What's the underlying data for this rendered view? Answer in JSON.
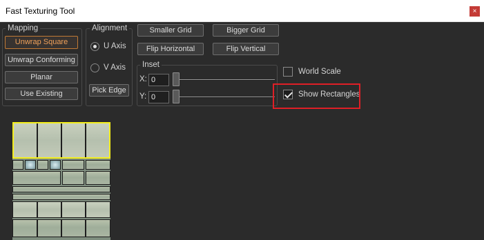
{
  "window": {
    "title": "Fast Texturing Tool",
    "close_glyph": "×"
  },
  "mapping": {
    "legend": "Mapping",
    "buttons": [
      "Unwrap Square",
      "Unwrap Conforming",
      "Planar",
      "Use Existing"
    ],
    "active_index": 0
  },
  "alignment": {
    "legend": "Alignment",
    "u_axis": "U Axis",
    "v_axis": "V Axis",
    "selected": "U Axis",
    "pick_edge": "Pick Edge"
  },
  "grid_buttons": {
    "smaller_grid": "Smaller Grid",
    "bigger_grid": "Bigger Grid",
    "flip_horizontal": "Flip Horizontal",
    "flip_vertical": "Flip Vertical"
  },
  "inset": {
    "legend": "Inset",
    "x_label": "X:",
    "x_value": "0",
    "y_label": "Y:",
    "y_value": "0"
  },
  "options": {
    "world_scale": {
      "label": "World Scale",
      "checked": false
    },
    "show_rectangles": {
      "label": "Show Rectangles",
      "checked": true
    }
  },
  "colors": {
    "background": "#2b2b2b",
    "active_button": "#c27a35",
    "highlight_box": "#e01f26",
    "selection_rect": "#f4ee1b"
  }
}
